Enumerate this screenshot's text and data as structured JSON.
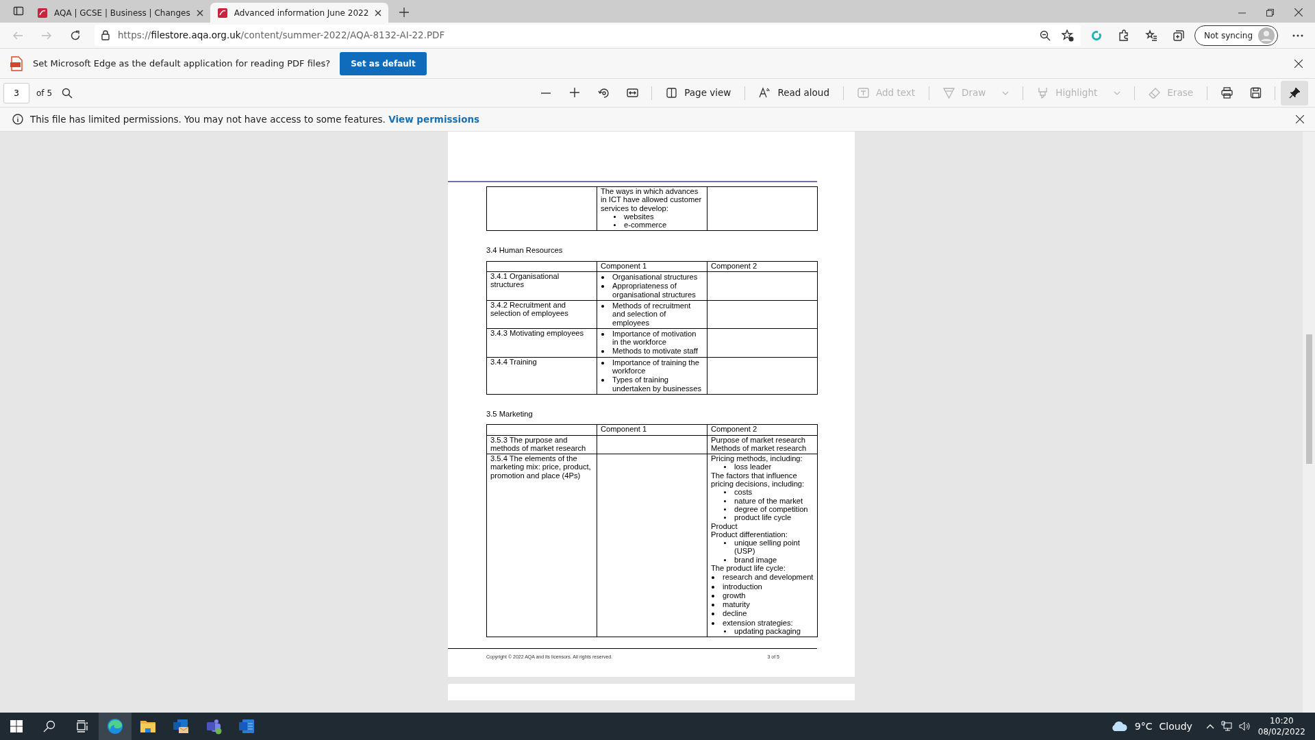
{
  "browser": {
    "tabs": [
      {
        "title": "AQA | GCSE | Business | Changes",
        "selected": false
      },
      {
        "title": "Advanced information June 2022",
        "selected": true
      }
    ],
    "address": {
      "scheme": "https://",
      "host": "filestore.aqa.org.uk",
      "path": "/content/summer-2022/AQA-8132-AI-22.PDF"
    },
    "profile_button": "Not syncing"
  },
  "default_app_bar": {
    "message": "Set Microsoft Edge as the default application for reading PDF files?",
    "button": "Set as default"
  },
  "pdf_toolbar": {
    "page_number": "3",
    "page_count": "of 5",
    "tools": [
      {
        "label": "Page view",
        "disabled": false,
        "dropdown": false,
        "kind": "pageview"
      },
      {
        "label": "Read aloud",
        "disabled": false,
        "dropdown": false,
        "kind": "readaloud"
      },
      {
        "label": "Add text",
        "disabled": true,
        "dropdown": false,
        "kind": "addtext"
      },
      {
        "label": "Draw",
        "disabled": true,
        "dropdown": true,
        "kind": "draw"
      },
      {
        "label": "Highlight",
        "disabled": true,
        "dropdown": true,
        "kind": "highlight"
      },
      {
        "label": "Erase",
        "disabled": true,
        "dropdown": false,
        "kind": "erase"
      }
    ],
    "pinned": true
  },
  "permissions_bar": {
    "message": "This file has limited permissions. You may not have access to some features.",
    "link": "View permissions"
  },
  "document": {
    "tables": [
      {
        "rows": [
          {
            "topic": "",
            "component_1": [
              {
                "kind": "text",
                "text": "The ways in which advances in ICT have allowed customer services to develop:"
              },
              {
                "kind": "sub_bullet",
                "text": "websites"
              },
              {
                "kind": "sub_bullet",
                "text": "e-commerce"
              }
            ],
            "component_2": []
          }
        ]
      },
      {
        "heading": "3.4 Human Resources",
        "columns": [
          "",
          "Component 1",
          "Component 2"
        ],
        "rows": [
          {
            "topic": "3.4.1 Organisational structures",
            "component_1": [
              {
                "kind": "bullet",
                "text": "Organisational structures"
              },
              {
                "kind": "bullet",
                "text": "Appropriateness of organisational structures"
              }
            ],
            "component_2": []
          },
          {
            "topic": "3.4.2 Recruitment and selection of employees",
            "component_1": [
              {
                "kind": "bullet",
                "text": "Methods of recruitment and selection of employees"
              }
            ],
            "component_2": []
          },
          {
            "topic": "3.4.3 Motivating employees",
            "component_1": [
              {
                "kind": "bullet",
                "text": "Importance of motivation in the workforce"
              },
              {
                "kind": "bullet",
                "text": "Methods to motivate staff"
              }
            ],
            "component_2": []
          },
          {
            "topic": "3.4.4 Training",
            "component_1": [
              {
                "kind": "bullet",
                "text": "Importance of training the workforce"
              },
              {
                "kind": "bullet",
                "text": "Types of training undertaken by businesses"
              }
            ],
            "component_2": []
          }
        ]
      },
      {
        "heading": "3.5 Marketing",
        "columns": [
          "",
          "Component 1",
          "Component 2"
        ],
        "rows": [
          {
            "topic": "3.5.3 The purpose and methods of market research",
            "component_1": [],
            "component_2": [
              {
                "kind": "text",
                "text": "Purpose of market research"
              },
              {
                "kind": "text",
                "text": "Methods of market research"
              }
            ]
          },
          {
            "topic": "3.5.4 The elements of the marketing mix: price, product, promotion and place (4Ps)",
            "component_1": [],
            "component_2": [
              {
                "kind": "text",
                "text": "Pricing methods, including:"
              },
              {
                "kind": "sub_bullet",
                "text": "loss leader"
              },
              {
                "kind": "text",
                "text": "The factors that influence pricing decisions, including:"
              },
              {
                "kind": "sub_bullet",
                "text": "costs"
              },
              {
                "kind": "sub_bullet",
                "text": "nature of the market"
              },
              {
                "kind": "sub_bullet",
                "text": "degree of competition"
              },
              {
                "kind": "sub_bullet",
                "text": "product life cycle"
              },
              {
                "kind": "text",
                "text": "Product"
              },
              {
                "kind": "text",
                "text": "Product differentiation:"
              },
              {
                "kind": "sub_bullet",
                "text": "unique selling point (USP)"
              },
              {
                "kind": "sub_bullet",
                "text": "brand image"
              },
              {
                "kind": "text",
                "text": "The product life cycle:"
              },
              {
                "kind": "bullet",
                "text": "research and development"
              },
              {
                "kind": "bullet",
                "text": "introduction"
              },
              {
                "kind": "bullet",
                "text": "growth"
              },
              {
                "kind": "bullet",
                "text": "maturity"
              },
              {
                "kind": "bullet",
                "text": "decline"
              },
              {
                "kind": "bullet",
                "text": "extension strategies:"
              },
              {
                "kind": "sub_bullet",
                "text": "updating packaging"
              }
            ]
          }
        ]
      }
    ],
    "footer": {
      "copyright": "Copyright © 2022 AQA and its licensors. All rights reserved.",
      "page": "3 of 5"
    }
  },
  "taskbar": {
    "apps": [
      {
        "kind": "edge",
        "selected": true
      },
      {
        "kind": "explorer",
        "selected": false
      },
      {
        "kind": "outlook",
        "selected": false
      },
      {
        "kind": "teams",
        "selected": false
      },
      {
        "kind": "word",
        "selected": false
      }
    ],
    "temperature": "9°C",
    "weather": "Cloudy",
    "time": "10:20",
    "date": "08/02/2022"
  }
}
